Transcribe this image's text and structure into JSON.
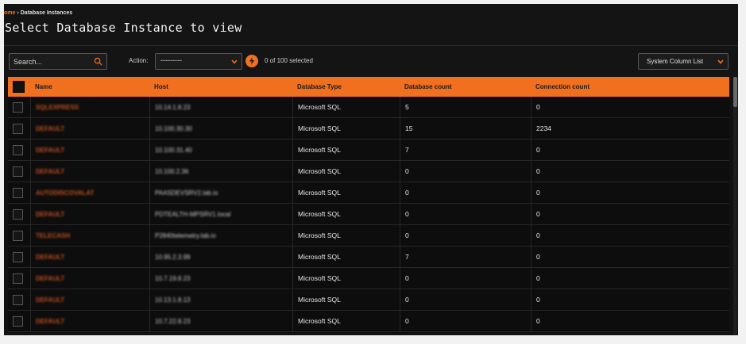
{
  "breadcrumb": {
    "home": "ome",
    "separator": "›",
    "current": "Database Instances"
  },
  "page_title": "Select Database Instance to view",
  "toolbar": {
    "search_placeholder": "Search...",
    "action_label": "Action:",
    "action_value": "---------",
    "selected_text": "0 of 100 selected",
    "column_list_label": "System Column List"
  },
  "colors": {
    "accent": "#f07020",
    "background": "#121212",
    "row": "#0d0d0d"
  },
  "icons": {
    "search": "search-icon",
    "run": "lightning-icon",
    "dropdown": "chevron-down-icon"
  },
  "table": {
    "headers": [
      "Name",
      "Host",
      "Database Type",
      "Database count",
      "Connection count"
    ],
    "rows": [
      {
        "name": "SQLEXPRESS",
        "host": "10.14.1.8.23",
        "type": "Microsoft SQL",
        "db_count": "5",
        "conn_count": "0"
      },
      {
        "name": "DEFAULT",
        "host": "10.100.30.30",
        "type": "Microsoft SQL",
        "db_count": "15",
        "conn_count": "2234"
      },
      {
        "name": "DEFAULT",
        "host": "10.100.31.40",
        "type": "Microsoft SQL",
        "db_count": "7",
        "conn_count": "0"
      },
      {
        "name": "DEFAULT",
        "host": "10.100.2.36",
        "type": "Microsoft SQL",
        "db_count": "0",
        "conn_count": "0"
      },
      {
        "name": "AUTODISCOVALAT",
        "host": "PAASDEVSRV2.lab.io",
        "type": "Microsoft SQL",
        "db_count": "0",
        "conn_count": "0"
      },
      {
        "name": "DEFAULT",
        "host": "PDTEALTH-MPSRV1.local",
        "type": "Microsoft SQL",
        "db_count": "0",
        "conn_count": "0"
      },
      {
        "name": "TELECASH",
        "host": "P2840telemetry.lab.io",
        "type": "Microsoft SQL",
        "db_count": "0",
        "conn_count": "0"
      },
      {
        "name": "DEFAULT",
        "host": "10.95.2.3.99",
        "type": "Microsoft SQL",
        "db_count": "7",
        "conn_count": "0"
      },
      {
        "name": "DEFAULT",
        "host": "10.7.19.8.23",
        "type": "Microsoft SQL",
        "db_count": "0",
        "conn_count": "0"
      },
      {
        "name": "DEFAULT",
        "host": "10.13.1.8.13",
        "type": "Microsoft SQL",
        "db_count": "0",
        "conn_count": "0"
      },
      {
        "name": "DEFAULT",
        "host": "10.7.22.8.23",
        "type": "Microsoft SQL",
        "db_count": "0",
        "conn_count": "0"
      }
    ]
  }
}
